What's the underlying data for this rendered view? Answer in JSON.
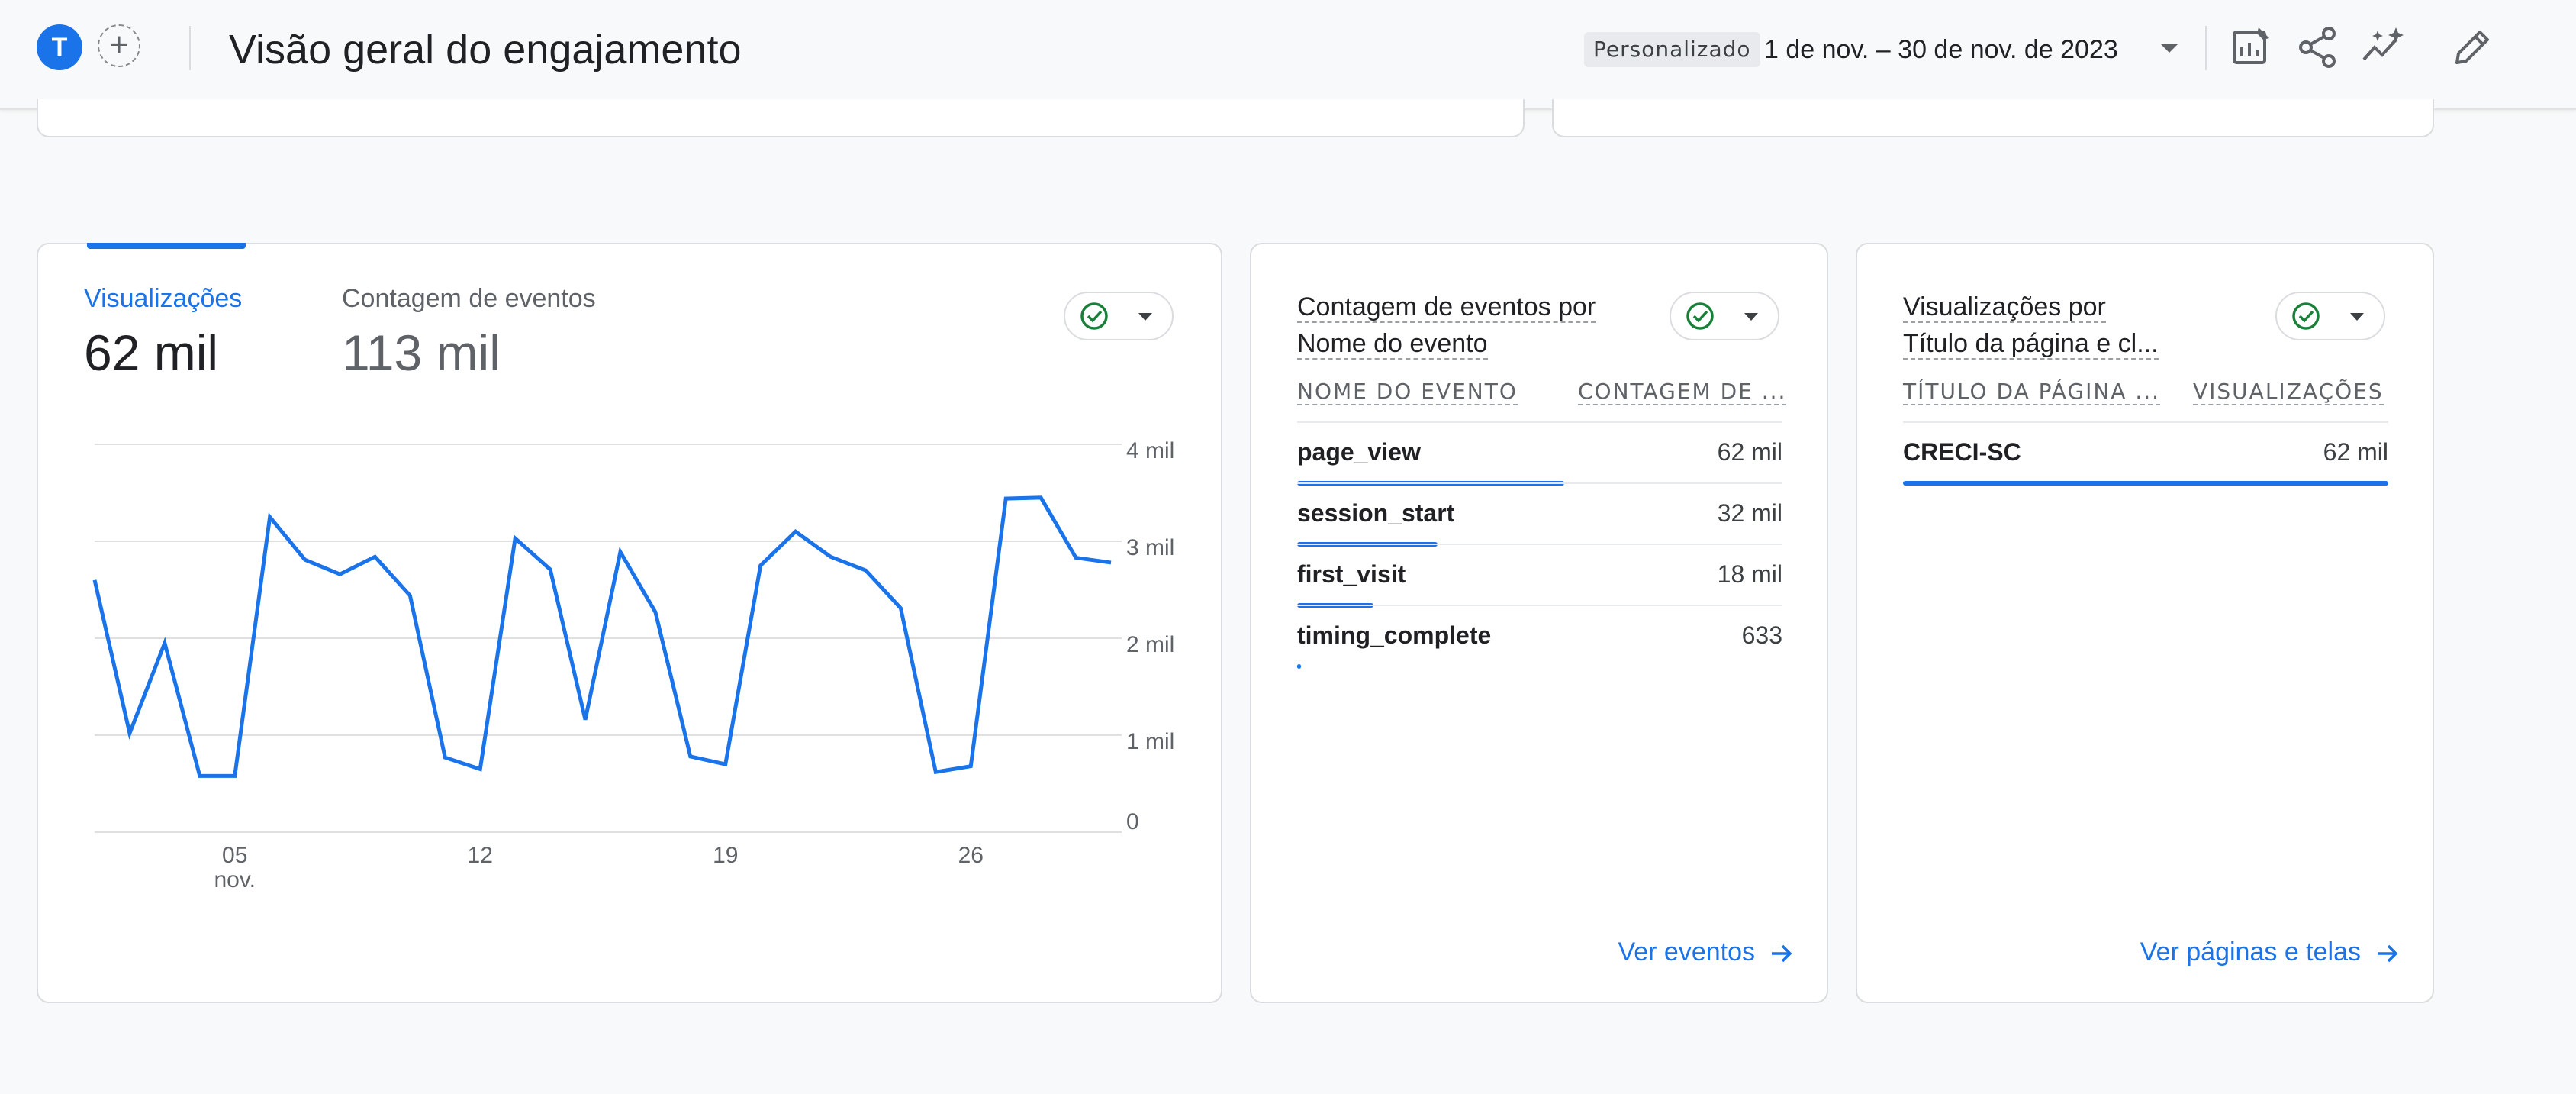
{
  "header": {
    "avatar_letter": "T",
    "add_symbol": "+",
    "title": "Visão geral do engajamento",
    "date_label": "Personalizado",
    "date_range": "1 de nov. – 30 de nov. de 2023",
    "icons": [
      "customize-report-icon",
      "share-icon",
      "insights-icon",
      "edit-icon"
    ]
  },
  "metrics_card": {
    "metric_1_label": "Visualizações",
    "metric_1_value": "62 mil",
    "metric_2_label": "Contagem de eventos",
    "metric_2_value": "113 mil"
  },
  "chart_data": {
    "type": "line",
    "x": [
      1,
      2,
      3,
      4,
      5,
      6,
      7,
      8,
      9,
      10,
      11,
      12,
      13,
      14,
      15,
      16,
      17,
      18,
      19,
      20,
      21,
      22,
      23,
      24,
      25,
      26,
      27,
      28,
      29,
      30
    ],
    "series": [
      {
        "values": [
          2600,
          1020,
          1950,
          580,
          580,
          3250,
          2810,
          2660,
          2840,
          2440,
          770,
          650,
          3030,
          2710,
          1160,
          2890,
          2270,
          780,
          700,
          2750,
          3100,
          2840,
          2700,
          2310,
          620,
          680,
          3440,
          3450,
          2830,
          2780
        ]
      }
    ],
    "x_tick_labels": [
      "05",
      "12",
      "19",
      "26"
    ],
    "x_tick_days": [
      5,
      12,
      19,
      26
    ],
    "x_sublabel": "nov.",
    "y_tick_labels": [
      "4 mil",
      "3 mil",
      "2 mil",
      "1 mil",
      "0"
    ],
    "y_tick_values": [
      4000,
      3000,
      2000,
      1000,
      0
    ],
    "ylim": [
      0,
      4000
    ],
    "grid": true,
    "line_color": "#1a73e8"
  },
  "events_card": {
    "title_line1": "Contagem de eventos por",
    "title_line2": "Nome do evento",
    "col_1": "NOME DO EVENTO",
    "col_2": "CONTAGEM DE ...",
    "rows": [
      {
        "name": "page_view",
        "value": "62 mil",
        "share": 0.55
      },
      {
        "name": "session_start",
        "value": "32 mil",
        "share": 0.29
      },
      {
        "name": "first_visit",
        "value": "18 mil",
        "share": 0.16
      },
      {
        "name": "timing_complete",
        "value": "633",
        "share": 0.006
      }
    ],
    "link": "Ver eventos"
  },
  "pages_card": {
    "title_line1": "Visualizações por",
    "title_line2": "Título da página e cl...",
    "col_1": "TÍTULO DA PÁGINA ...",
    "col_2": "VISUALIZAÇÕES",
    "rows": [
      {
        "name": "CRECI-SC",
        "value": "62 mil",
        "share": 1.0
      }
    ],
    "link": "Ver páginas e telas"
  },
  "colors": {
    "accent": "#1a73e8",
    "check_green": "#188038"
  }
}
